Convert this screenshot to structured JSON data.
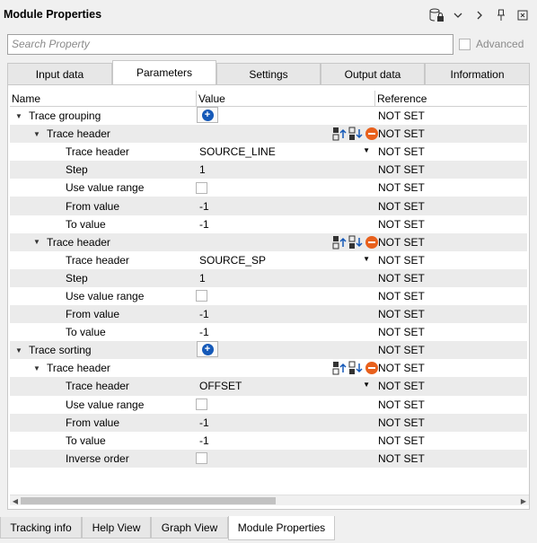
{
  "window": {
    "title": "Module Properties",
    "icons": [
      "database-lock-icon",
      "chevron-down-icon",
      "chevron-right-icon",
      "pin-icon",
      "close-icon"
    ]
  },
  "search": {
    "placeholder": "Search Property"
  },
  "advanced": {
    "label": "Advanced",
    "checked": false
  },
  "tabs": [
    {
      "label": "Input data",
      "active": false
    },
    {
      "label": "Parameters",
      "active": true
    },
    {
      "label": "Settings",
      "active": false
    },
    {
      "label": "Output data",
      "active": false
    },
    {
      "label": "Information",
      "active": false
    }
  ],
  "columns": {
    "name": "Name",
    "value": "Value",
    "reference": "Reference"
  },
  "rows": [
    {
      "name": "Trace grouping",
      "level": 0,
      "expanded": true,
      "value": "",
      "value_kind": "add",
      "reference": "NOT SET"
    },
    {
      "name": "Trace header",
      "level": 1,
      "expanded": true,
      "value": "",
      "value_kind": "actions",
      "reference": "NOT SET"
    },
    {
      "name": "Trace header",
      "level": 2,
      "value": "SOURCE_LINE",
      "value_kind": "combo",
      "reference": "NOT SET"
    },
    {
      "name": "Step",
      "level": 2,
      "value": "1",
      "value_kind": "text",
      "reference": "NOT SET"
    },
    {
      "name": "Use value range",
      "level": 2,
      "value": "",
      "value_kind": "checkbox",
      "reference": "NOT SET"
    },
    {
      "name": "From value",
      "level": 2,
      "value": "-1",
      "value_kind": "text",
      "reference": "NOT SET"
    },
    {
      "name": "To value",
      "level": 2,
      "value": "-1",
      "value_kind": "text",
      "reference": "NOT SET"
    },
    {
      "name": "Trace header",
      "level": 1,
      "expanded": true,
      "value": "",
      "value_kind": "actions",
      "reference": "NOT SET"
    },
    {
      "name": "Trace header",
      "level": 2,
      "value": "SOURCE_SP",
      "value_kind": "combo",
      "reference": "NOT SET"
    },
    {
      "name": "Step",
      "level": 2,
      "value": "1",
      "value_kind": "text",
      "reference": "NOT SET"
    },
    {
      "name": "Use value range",
      "level": 2,
      "value": "",
      "value_kind": "checkbox",
      "reference": "NOT SET"
    },
    {
      "name": "From value",
      "level": 2,
      "value": "-1",
      "value_kind": "text",
      "reference": "NOT SET"
    },
    {
      "name": "To value",
      "level": 2,
      "value": "-1",
      "value_kind": "text",
      "reference": "NOT SET"
    },
    {
      "name": "Trace sorting",
      "level": 0,
      "expanded": true,
      "value": "",
      "value_kind": "add",
      "reference": "NOT SET"
    },
    {
      "name": "Trace header",
      "level": 1,
      "expanded": true,
      "value": "",
      "value_kind": "actions",
      "reference": "NOT SET"
    },
    {
      "name": "Trace header",
      "level": 2,
      "value": "OFFSET",
      "value_kind": "combo",
      "reference": "NOT SET"
    },
    {
      "name": "Use value range",
      "level": 2,
      "value": "",
      "value_kind": "checkbox",
      "reference": "NOT SET"
    },
    {
      "name": "From value",
      "level": 2,
      "value": "-1",
      "value_kind": "text",
      "reference": "NOT SET"
    },
    {
      "name": "To value",
      "level": 2,
      "value": "-1",
      "value_kind": "text",
      "reference": "NOT SET"
    },
    {
      "name": "Inverse order",
      "level": 2,
      "value": "",
      "value_kind": "checkbox",
      "reference": "NOT SET"
    }
  ],
  "bottom_tabs": [
    {
      "label": "Tracking info",
      "active": false
    },
    {
      "label": "Help View",
      "active": false
    },
    {
      "label": "Graph View",
      "active": false
    },
    {
      "label": "Module Properties",
      "active": true
    }
  ],
  "colors": {
    "accent_blue": "#1559b8",
    "remove_orange": "#e8601c",
    "row_alt": "#ebebeb"
  }
}
